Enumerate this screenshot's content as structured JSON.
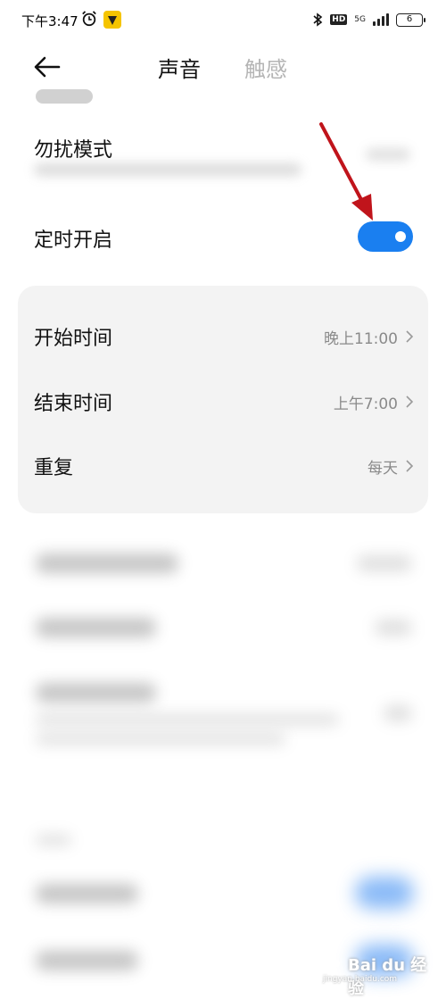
{
  "status_bar": {
    "time": "下午3:47",
    "hd": "HD",
    "network": "5G",
    "battery": "6"
  },
  "header": {
    "tabs": [
      {
        "label": "声音",
        "active": true
      },
      {
        "label": "触感",
        "active": false
      }
    ]
  },
  "settings": {
    "dnd_label": "勿扰模式",
    "scheduled_label": "定时开启",
    "scheduled_on": true,
    "schedule_items": [
      {
        "label": "开始时间",
        "value": "晚上11:00"
      },
      {
        "label": "结束时间",
        "value": "上午7:00"
      },
      {
        "label": "重复",
        "value": "每天"
      }
    ]
  },
  "watermark": {
    "brand": "Bai du 经验",
    "url": "jingyan.baidu.com"
  },
  "colors": {
    "accent": "#1a7ff0",
    "annotation": "#c0141b"
  }
}
